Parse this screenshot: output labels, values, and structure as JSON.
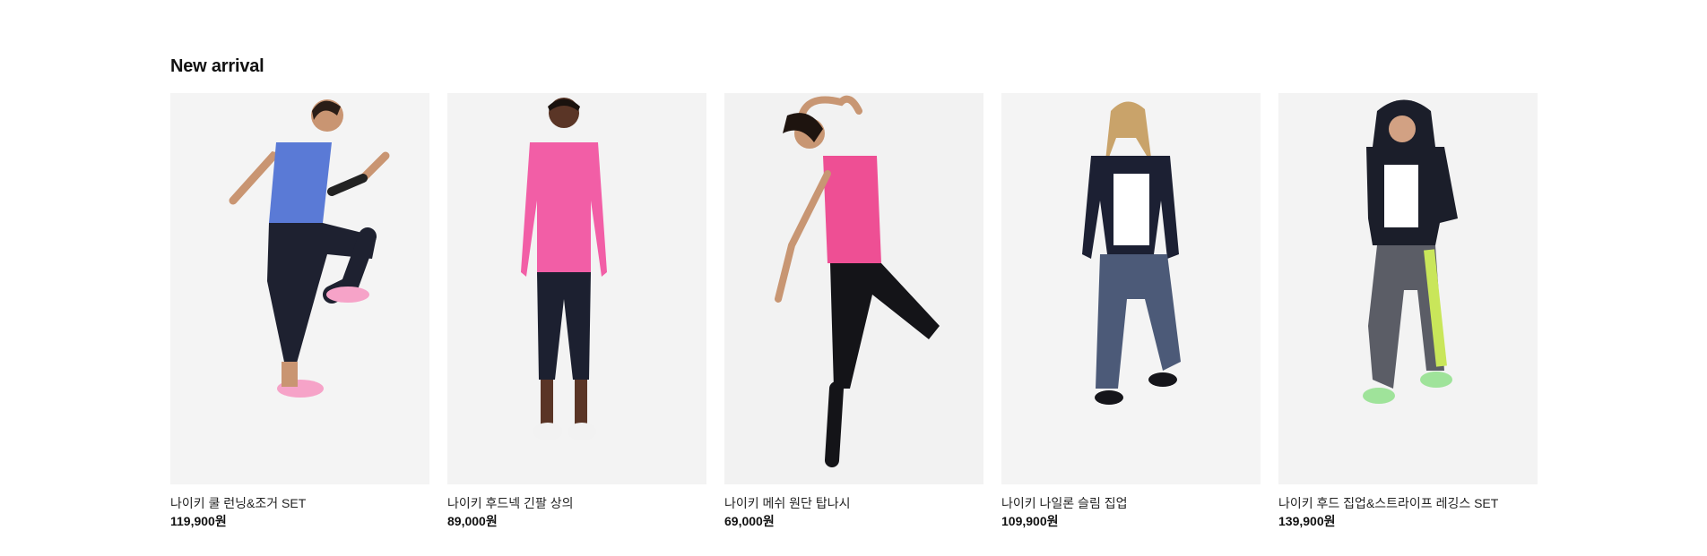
{
  "section": {
    "title": "New arrival"
  },
  "products": [
    {
      "name": "나이키 쿨 런닝&조거 SET",
      "price": "119,900원",
      "colors": {
        "top": "#5a7ad6",
        "bottom": "#1e2130",
        "shoe": "#f6a3c8",
        "skin": "#c99572",
        "hair": "#2a1d16"
      }
    },
    {
      "name": "나이키 후드넥 긴팔 상의",
      "price": "89,000원",
      "colors": {
        "top": "#f25ea6",
        "bottom": "#1c2030",
        "shoe": "#f2f2f2",
        "skin": "#5a3526",
        "hair": "#1a120e"
      }
    },
    {
      "name": "나이키 메쉬 원단 탑나시",
      "price": "69,000원",
      "colors": {
        "top": "#ee4f94",
        "bottom": "#141418",
        "shoe": "#141418",
        "skin": "#c89673",
        "hair": "#1e140f"
      }
    },
    {
      "name": "나이키 나일론 슬림 집업",
      "price": "109,900원",
      "colors": {
        "top": "#1c2033",
        "bottom": "#4c5a78",
        "shoe": "#15151a",
        "skin": "#d7a98a",
        "hair": "#c9a36a"
      }
    },
    {
      "name": "나이키 후드 집업&스트라이프 레깅스 SET",
      "price": "139,900원",
      "colors": {
        "top": "#1b1e2a",
        "bottom": "#5b5d66",
        "shoe": "#9fe39a",
        "skin": "#d2a183",
        "hair": "#3a2619"
      }
    }
  ]
}
